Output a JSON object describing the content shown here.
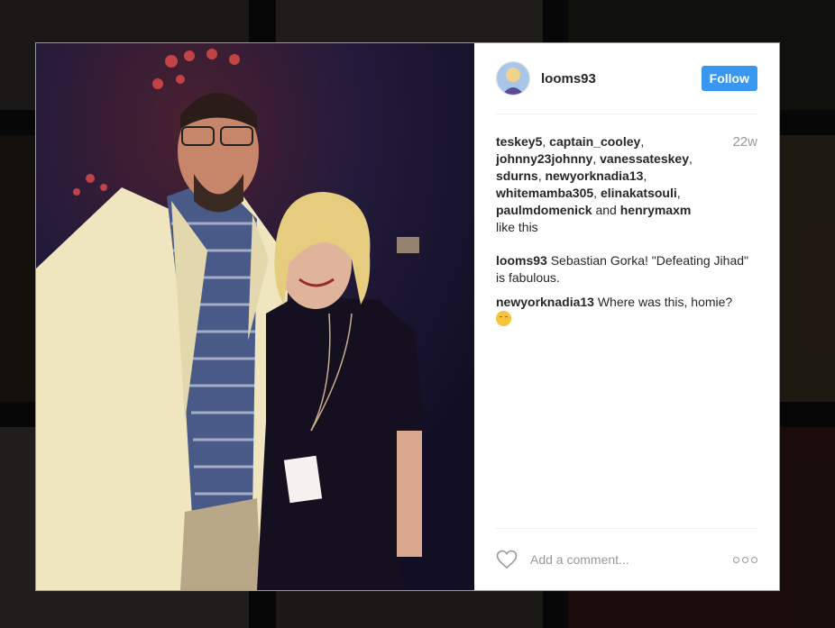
{
  "post": {
    "username": "looms93",
    "follow_label": "Follow",
    "time": "22w",
    "likes": {
      "users": [
        "teskey5",
        "captain_cooley",
        "johnny23johnny",
        "vanessateskey",
        "sdurns",
        "newyorknadia13",
        "whitemamba305",
        "elinakatsouli",
        "paulmdomenick"
      ],
      "and_word": "and",
      "last_user": "henrymaxm",
      "suffix": "like this"
    },
    "comments": [
      {
        "user": "looms93",
        "text": "Sebastian Gorka! \"Defeating Jihad\" is fabulous."
      },
      {
        "user": "newyorknadia13",
        "text": "Where was this, homie?",
        "emoji": "relieved-face-emoji"
      }
    ],
    "comment_placeholder": "Add a comment..."
  },
  "colors": {
    "follow_button": "#3897f0",
    "time_gray": "#999999",
    "text": "#262626"
  },
  "icons": [
    "heart-icon",
    "more-options-icon"
  ]
}
